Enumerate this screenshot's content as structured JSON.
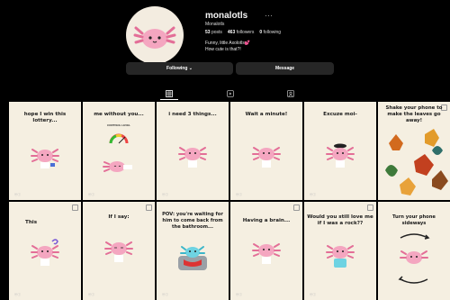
{
  "profile": {
    "username": "monalotls",
    "more_glyph": "···",
    "display_name": "Monalotls",
    "stats": {
      "posts_count": "53",
      "posts_label": "posts",
      "followers_count": "463",
      "followers_label": "followers",
      "following_count": "0",
      "following_label": "following"
    },
    "bio_line1": "Funny, little Axolotls💕",
    "bio_line2": "How cute is that?!"
  },
  "actions": {
    "following_label": "Following ⌄",
    "message_label": "Message"
  },
  "tabs": [
    {
      "name": "posts",
      "icon": "grid-icon"
    },
    {
      "name": "reels",
      "icon": "reels-icon"
    },
    {
      "name": "tagged",
      "icon": "tagged-icon"
    }
  ],
  "tiles": [
    {
      "caption": "hope I win this lottery..."
    },
    {
      "caption": "me without you...",
      "sign": "CORTISOL LEVEL"
    },
    {
      "caption": "i need 3 things..."
    },
    {
      "caption": "Wait a minute!"
    },
    {
      "caption": "Excuze moi-"
    },
    {
      "caption": "Shake your phone to make the leaves go away!"
    },
    {
      "caption": "This"
    },
    {
      "caption": "If I say:"
    },
    {
      "caption": "POV: you're waiting for him to come back from the bathroom..."
    },
    {
      "caption": "Having a brain..."
    },
    {
      "caption": "Would you still love me if I was a rock??"
    },
    {
      "caption": "Turn your phone sideways"
    }
  ],
  "colors": {
    "background": "#000000",
    "button": "#262626",
    "tile_bg": "#f5efe1",
    "axolotl_pink": "#f4a6c0",
    "axolotl_cyan": "#6ed3e2"
  }
}
